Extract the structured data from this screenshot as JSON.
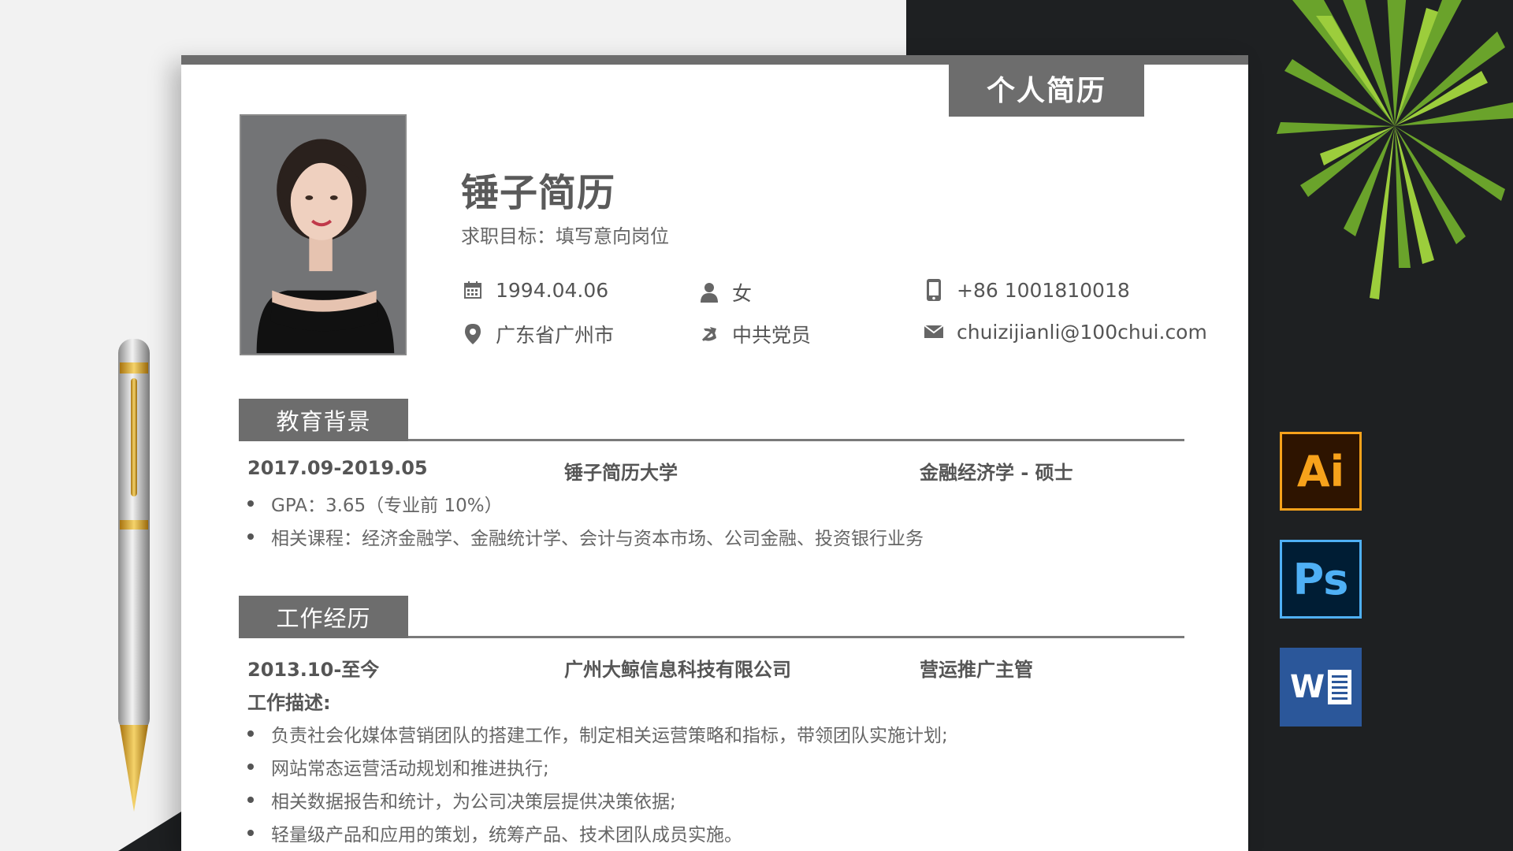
{
  "resume": {
    "title_tab": "个人简历",
    "name": "锤子简历",
    "objective": "求职目标：填写意向岗位",
    "info": {
      "birthday": "1994.04.06",
      "gender": "女",
      "phone": "+86 1001810018",
      "location": "广东省广州市",
      "politics": "中共党员",
      "email": "chuizijianli@100chui.com"
    },
    "education": {
      "heading": "教育背景",
      "period": "2017.09-2019.05",
      "school": "锤子简历大学",
      "major": "金融经济学 - 硕士",
      "bullets": [
        "GPA：3.65（专业前 10%）",
        "相关课程：经济金融学、金融统计学、会计与资本市场、公司金融、投资银行业务"
      ]
    },
    "work": {
      "heading": "工作经历",
      "period": "2013.10-至今",
      "company": "广州大鲸信息科技有限公司",
      "role": "营运推广主管",
      "desc_label": "工作描述:",
      "bullets": [
        "负责社会化媒体营销团队的搭建工作，制定相关运营策略和指标，带领团队实施计划;",
        "网站常态运营活动规划和推进执行;",
        "相关数据报告和统计，为公司决策层提供决策依据;",
        "轻量级产品和应用的策划，统筹产品、技术团队成员实施。"
      ]
    }
  },
  "software_icons": [
    {
      "label": "Ai",
      "bg": "#2e1400",
      "fg": "#f7a21b"
    },
    {
      "label": "Ps",
      "bg": "#001d34",
      "fg": "#4fb0f5"
    },
    {
      "label": "W",
      "bg": "#2b579a",
      "fg": "#ffffff"
    }
  ],
  "colors": {
    "accent_gray": "#6d6d6d",
    "dark_bg": "#1e2022"
  }
}
